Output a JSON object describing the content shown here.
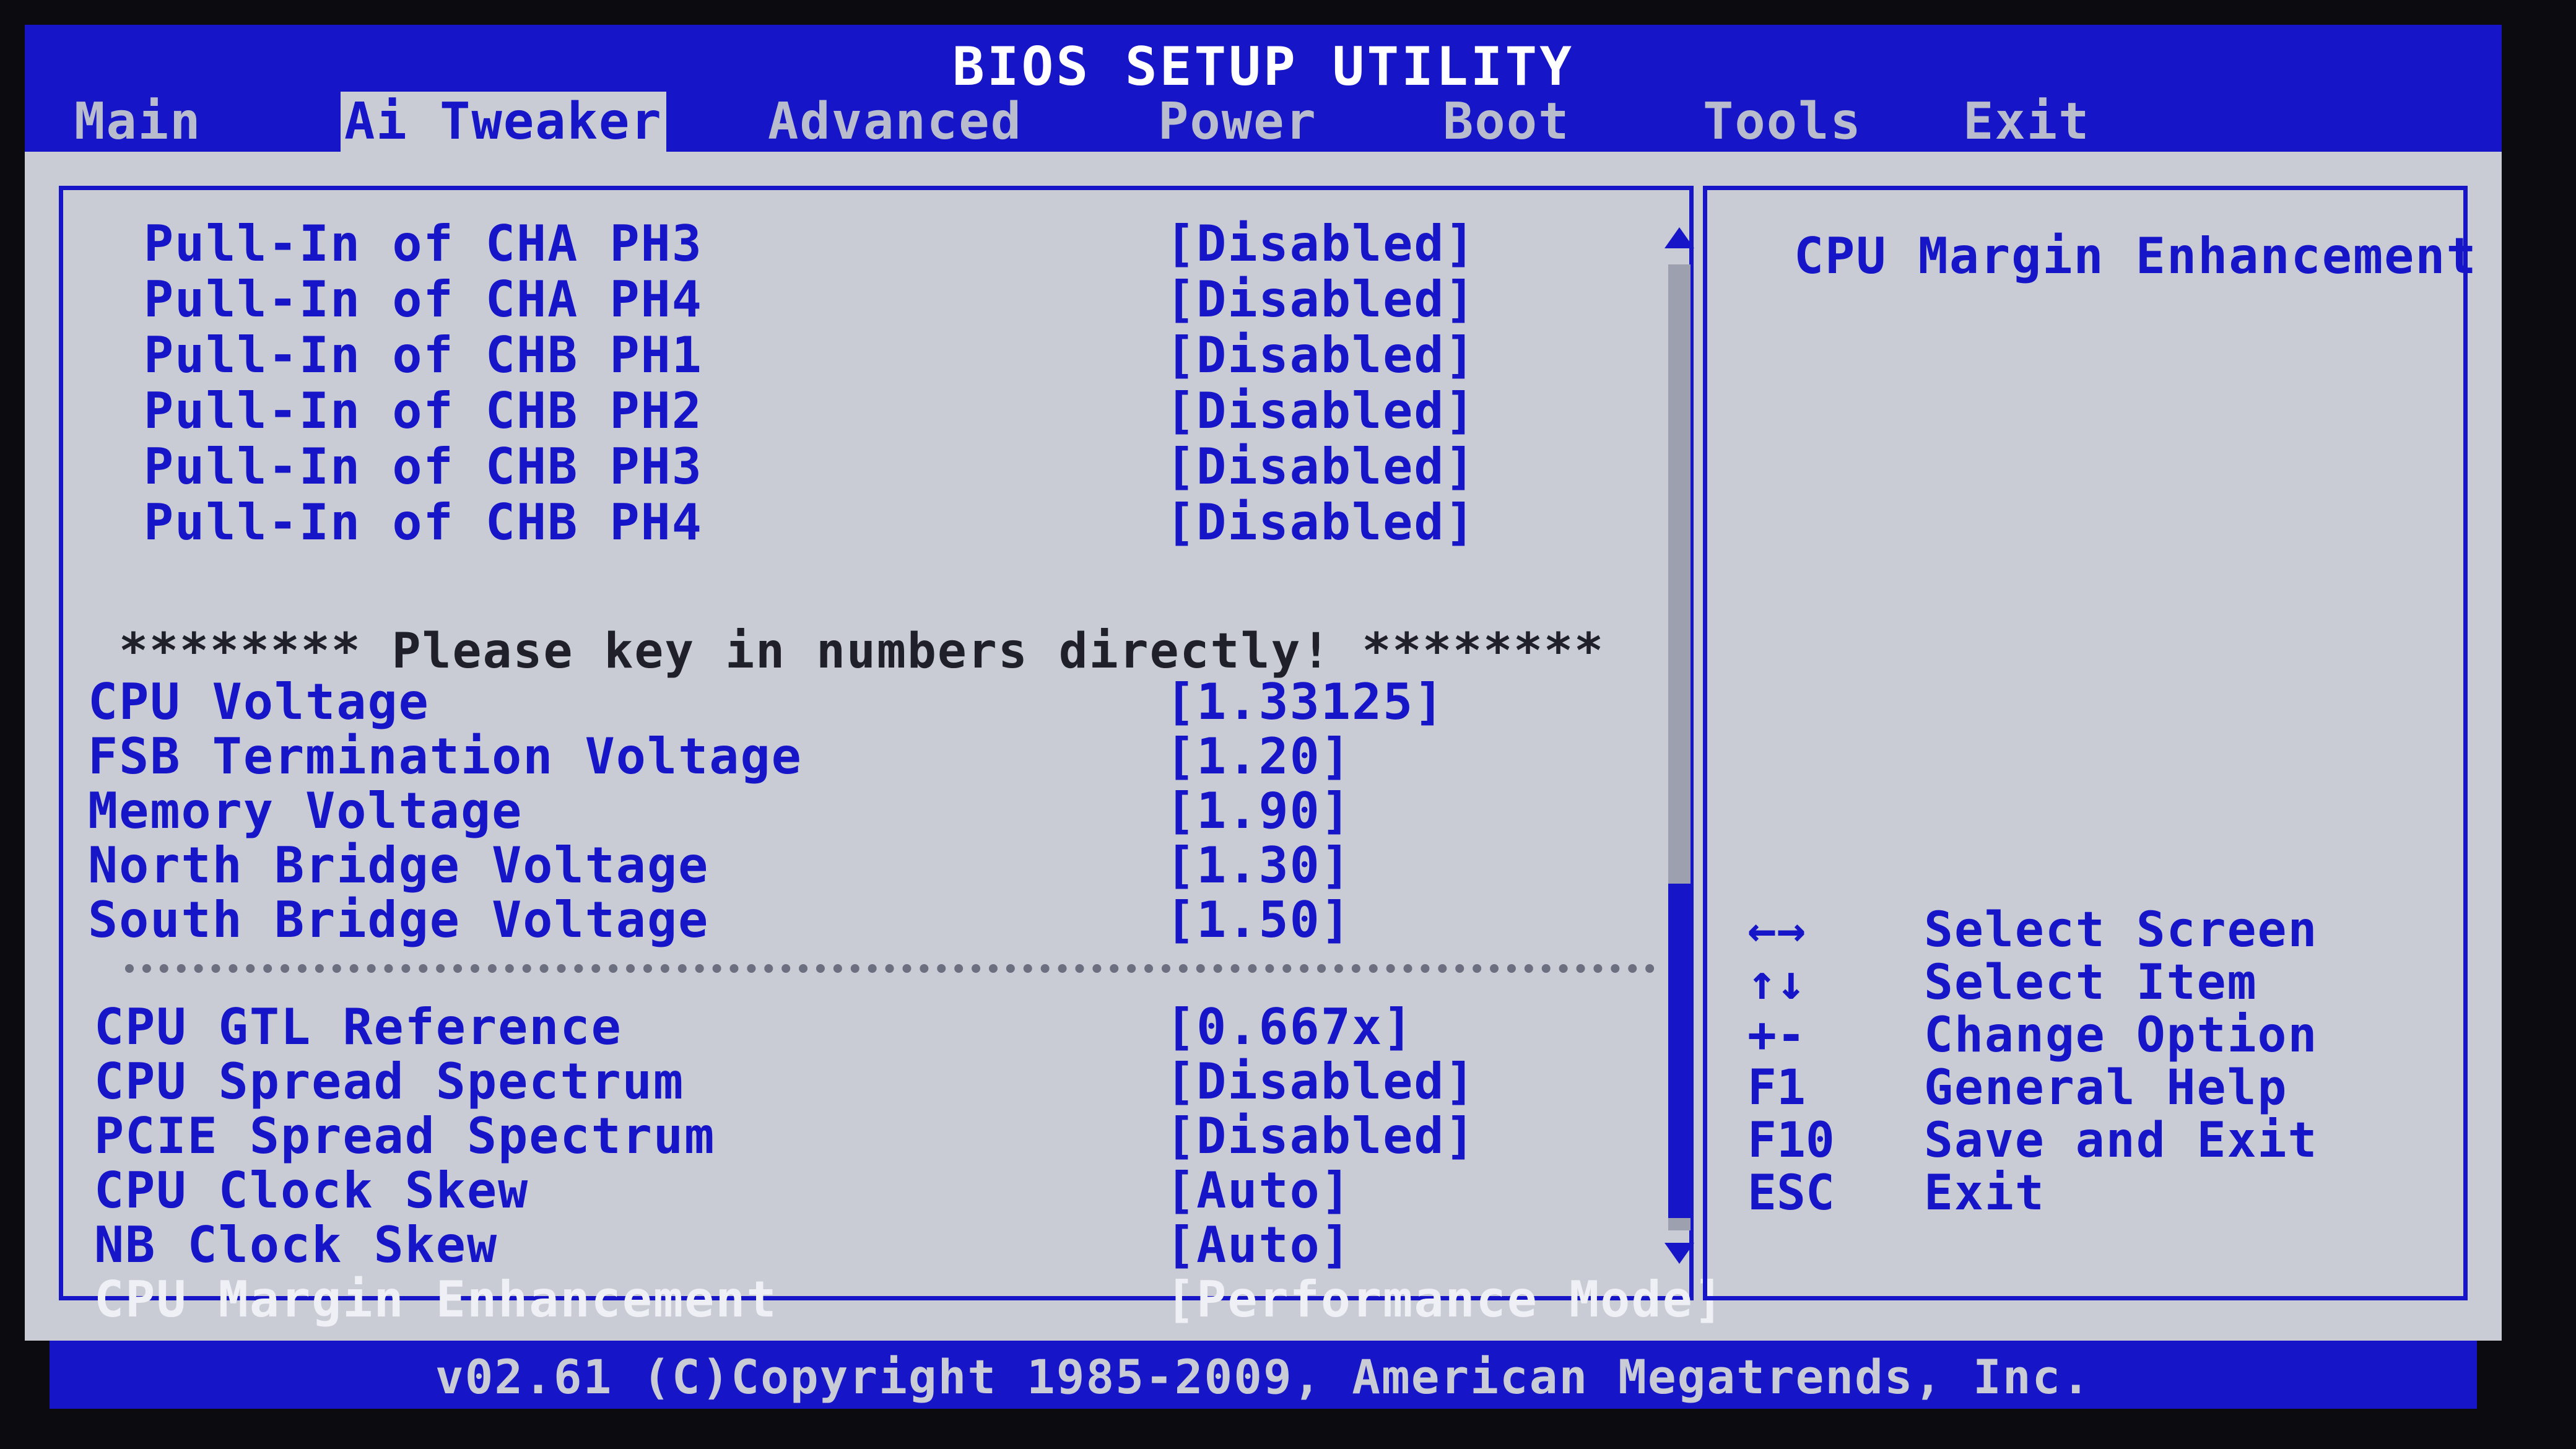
{
  "title": "BIOS SETUP UTILITY",
  "tabs": [
    {
      "label": "Main"
    },
    {
      "label": "Ai Tweaker"
    },
    {
      "label": "Advanced"
    },
    {
      "label": "Power"
    },
    {
      "label": "Boot"
    },
    {
      "label": "Tools"
    },
    {
      "label": "Exit"
    }
  ],
  "active_tab": "Ai Tweaker",
  "pull_in_settings": [
    {
      "label": "Pull-In of CHA PH3",
      "value": "[Disabled]"
    },
    {
      "label": "Pull-In of CHA PH4",
      "value": "[Disabled]"
    },
    {
      "label": "Pull-In of CHB PH1",
      "value": "[Disabled]"
    },
    {
      "label": "Pull-In of CHB PH2",
      "value": "[Disabled]"
    },
    {
      "label": "Pull-In of CHB PH3",
      "value": "[Disabled]"
    },
    {
      "label": "Pull-In of CHB PH4",
      "value": "[Disabled]"
    }
  ],
  "voltage_note": "******** Please key in numbers directly! ********",
  "voltage_settings": [
    {
      "label": "CPU Voltage",
      "value": "[1.33125]"
    },
    {
      "label": "FSB Termination Voltage",
      "value": "[1.20]"
    },
    {
      "label": "Memory Voltage",
      "value": "[1.90]"
    },
    {
      "label": "North Bridge Voltage",
      "value": "[1.30]"
    },
    {
      "label": "South Bridge Voltage",
      "value": "[1.50]"
    }
  ],
  "other_settings": [
    {
      "label": "CPU GTL Reference",
      "value": "[0.667x]"
    },
    {
      "label": "CPU Spread Spectrum",
      "value": "[Disabled]"
    },
    {
      "label": "PCIE Spread Spectrum",
      "value": "[Disabled]"
    },
    {
      "label": "CPU Clock Skew",
      "value": "[Auto]"
    },
    {
      "label": "NB Clock Skew",
      "value": "[Auto]"
    },
    {
      "label": "CPU Margin Enhancement",
      "value": "[Performance Mode]"
    }
  ],
  "selected_item": "CPU Margin Enhancement",
  "help_title": "CPU Margin Enhancement",
  "key_help": [
    {
      "key": "←→",
      "action": "Select Screen"
    },
    {
      "key": "↑↓",
      "action": "Select Item"
    },
    {
      "key": "+-",
      "action": "Change Option"
    },
    {
      "key": "F1",
      "action": "General Help"
    },
    {
      "key": "F10",
      "action": "Save and Exit"
    },
    {
      "key": "ESC",
      "action": "Exit"
    }
  ],
  "footer": "v02.61 (C)Copyright 1985-2009, American Megatrends, Inc.",
  "colors": {
    "background": "#c9ccd4",
    "accent": "#1616c8",
    "selected_text": "#eef0f6"
  }
}
